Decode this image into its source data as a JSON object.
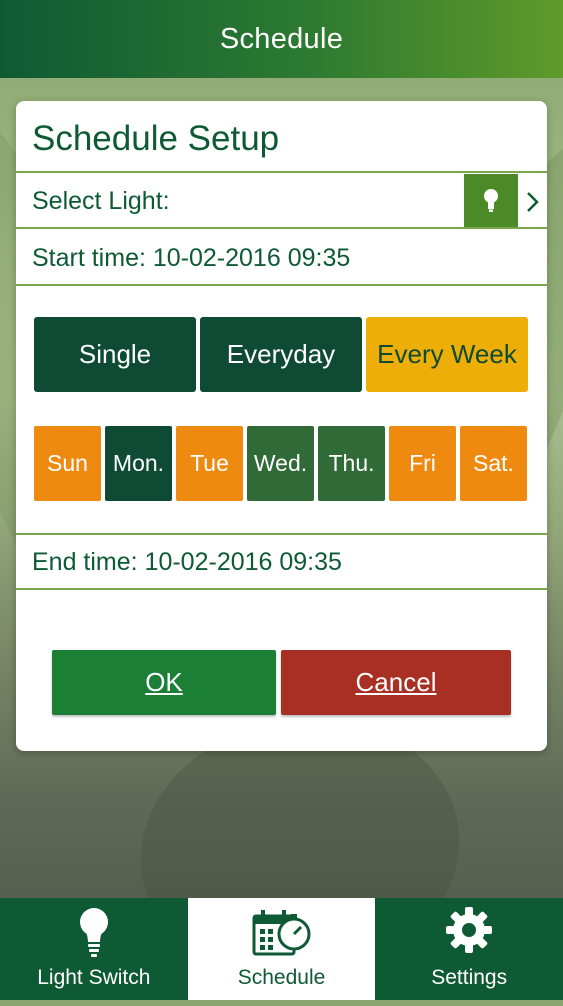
{
  "header": {
    "title": "Schedule"
  },
  "dialog": {
    "title": "Schedule Setup",
    "select_light_label": "Select Light:",
    "light_button_icon": "lightbulb-icon",
    "chevron_icon": "chevron-right-icon",
    "start_time": "Start time: 10-02-2016 09:35",
    "end_time": "End time: 10-02-2016 09:35",
    "modes": [
      {
        "label": "Single",
        "selected": false
      },
      {
        "label": "Everyday",
        "selected": false
      },
      {
        "label": "Every Week",
        "selected": true
      }
    ],
    "days": [
      {
        "label": "Sun",
        "state": "off"
      },
      {
        "label": "Mon.",
        "state": "on"
      },
      {
        "label": "Tue",
        "state": "off"
      },
      {
        "label": "Wed.",
        "state": "on"
      },
      {
        "label": "Thu.",
        "state": "on"
      },
      {
        "label": "Fri",
        "state": "off"
      },
      {
        "label": "Sat.",
        "state": "off"
      }
    ],
    "ok_label": "OK",
    "cancel_label": "Cancel"
  },
  "colors": {
    "primary_green": "#0e5a35",
    "selected_mode": "#eeae08",
    "day_off": "#ef8a10",
    "ok": "#1c7f36",
    "cancel": "#a82f24"
  },
  "bottom_nav": [
    {
      "label": "Light Switch",
      "icon": "lightbulb-icon",
      "active": false
    },
    {
      "label": "Schedule",
      "icon": "calendar-stopwatch-icon",
      "active": true
    },
    {
      "label": "Settings",
      "icon": "gear-icon",
      "active": false
    }
  ]
}
